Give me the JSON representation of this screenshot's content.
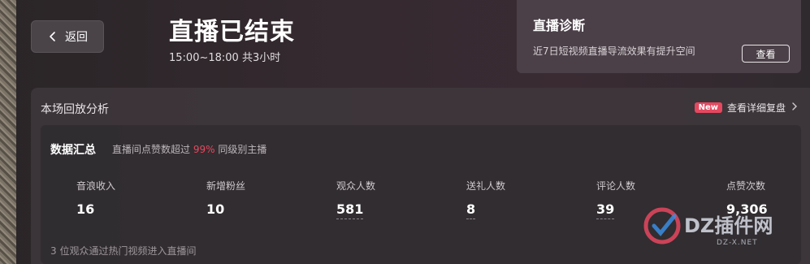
{
  "header": {
    "back_label": "返回",
    "title": "直播已结束",
    "time": "15:00~18:00 共3小时"
  },
  "diagnosis": {
    "title": "直播诊断",
    "desc": "近7日短视频直播导流效果有提升空间",
    "button": "查看"
  },
  "analysis": {
    "title": "本场回放分析",
    "badge": "New",
    "link": "查看详细复盘"
  },
  "summary": {
    "title": "数据汇总",
    "sub_prefix": "直播间点赞数超过",
    "sub_percent": "99%",
    "sub_suffix": "同级别主播",
    "metrics": [
      {
        "label": "音浪收入",
        "value": "16"
      },
      {
        "label": "新增粉丝",
        "value": "10"
      },
      {
        "label": "观众人数",
        "value": "581"
      },
      {
        "label": "送礼人数",
        "value": "8"
      },
      {
        "label": "评论人数",
        "value": "39"
      },
      {
        "label": "点赞次数",
        "value": "9,306"
      }
    ],
    "footnote": "3 位观众通过热门视频进入直播间"
  },
  "watermark": {
    "text": "DZ插件网",
    "sub": "DZ-X.NET"
  },
  "colors": {
    "accent": "#e5485f",
    "background": "#352a30"
  }
}
